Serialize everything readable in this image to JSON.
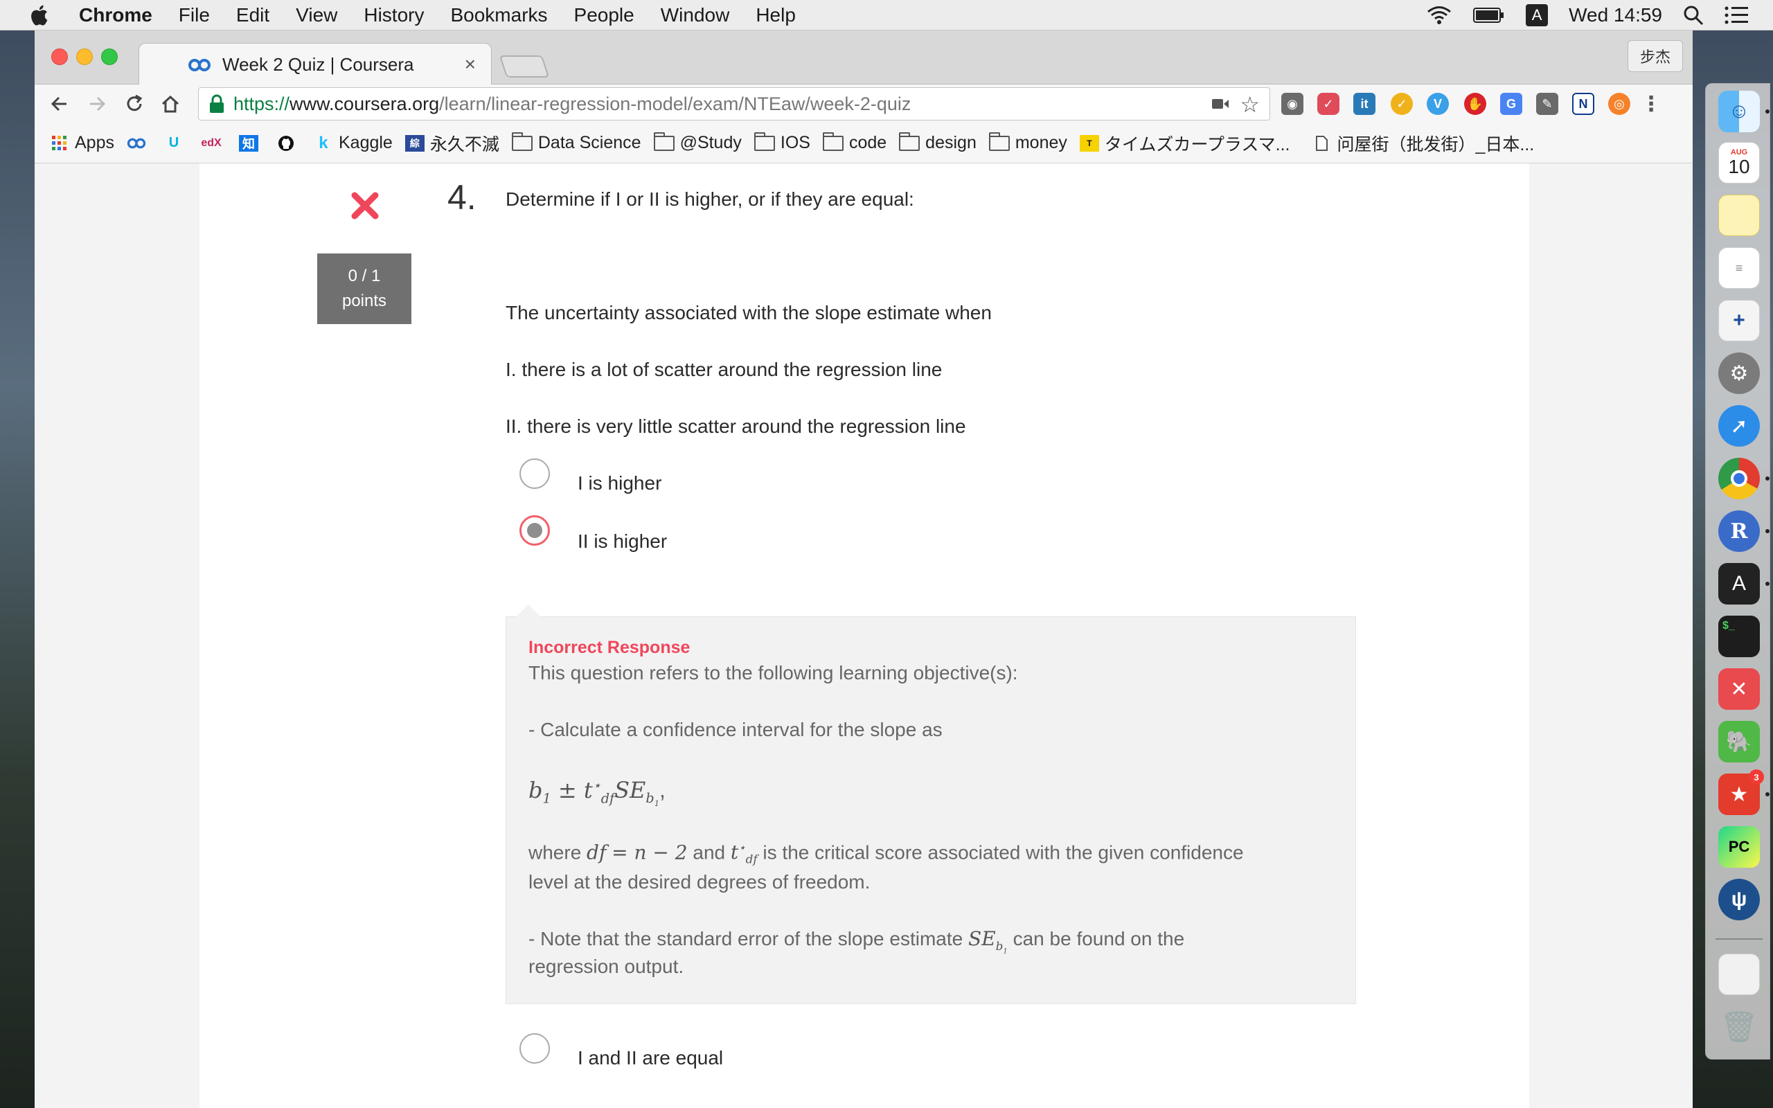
{
  "menubar": {
    "app_name": "Chrome",
    "menus": [
      "File",
      "Edit",
      "View",
      "History",
      "Bookmarks",
      "People",
      "Window",
      "Help"
    ],
    "input_indicator": "A",
    "clock": "Wed 14:59"
  },
  "browser": {
    "tab_title": "Week 2 Quiz | Coursera",
    "profile_name": "步杰",
    "url": {
      "scheme": "https://",
      "host": "www.coursera.org",
      "path": "/learn/linear-regression-model/exam/NTEaw/week-2-quiz"
    },
    "bookmarks": [
      {
        "label": "Apps",
        "icon": "apps-grid-icon"
      },
      {
        "label": "",
        "icon": "coursera-icon"
      },
      {
        "label": "",
        "icon": "udacity-icon"
      },
      {
        "label": "",
        "icon": "edx-icon"
      },
      {
        "label": "",
        "icon": "zhihu-icon"
      },
      {
        "label": "",
        "icon": "github-icon"
      },
      {
        "label": "Kaggle",
        "icon": "kaggle-icon"
      },
      {
        "label": "永久不滅",
        "icon": "site-icon"
      },
      {
        "label": "Data Science",
        "icon": "folder-icon"
      },
      {
        "label": "@Study",
        "icon": "folder-icon"
      },
      {
        "label": "IOS",
        "icon": "folder-icon"
      },
      {
        "label": "code",
        "icon": "folder-icon"
      },
      {
        "label": "design",
        "icon": "folder-icon"
      },
      {
        "label": "money",
        "icon": "folder-icon"
      },
      {
        "label": "タイムズカープラスマ...",
        "icon": "times-icon"
      },
      {
        "label": "问屋街（批发街）_日本...",
        "icon": "page-icon"
      }
    ]
  },
  "quiz": {
    "question_number": "4.",
    "question_title": "Determine if I or II is higher, or if they are equal:",
    "points_line1": "0 / 1",
    "points_line2": "points",
    "stem": "The uncertainty associated with the slope estimate when",
    "statement_1": "I. there is a lot of scatter around the regression line",
    "statement_2": "II. there is very little scatter around the regression line",
    "options": [
      "I is higher",
      "II is higher",
      "I and II are equal"
    ],
    "selected_option": "II is higher",
    "feedback": {
      "title": "Incorrect Response",
      "intro": "This question refers to the following learning objective(s):",
      "objective_1": "- Calculate a confidence interval for the slope as",
      "formula_end": ",",
      "where_prefix": "where",
      "where_eq": "= n − 2",
      "where_and": "and",
      "where_suffix": "is the critical score associated with the given confidence",
      "where_line2": "level at the desired degrees of freedom.",
      "note_prefix": "- Note that the standard error of the slope estimate",
      "note_suffix": "can be found on the",
      "note_line2": "regression output."
    }
  },
  "dock": {
    "calendar_month": "AUG",
    "calendar_day": "10",
    "r_label": "R",
    "font_label": "A",
    "terminal_label": "$_",
    "pycharm_label": "PC",
    "badge_count": "3"
  },
  "colors": {
    "accent_red": "#f0465b",
    "url_green": "#0b8043",
    "points_gray": "#707070"
  }
}
